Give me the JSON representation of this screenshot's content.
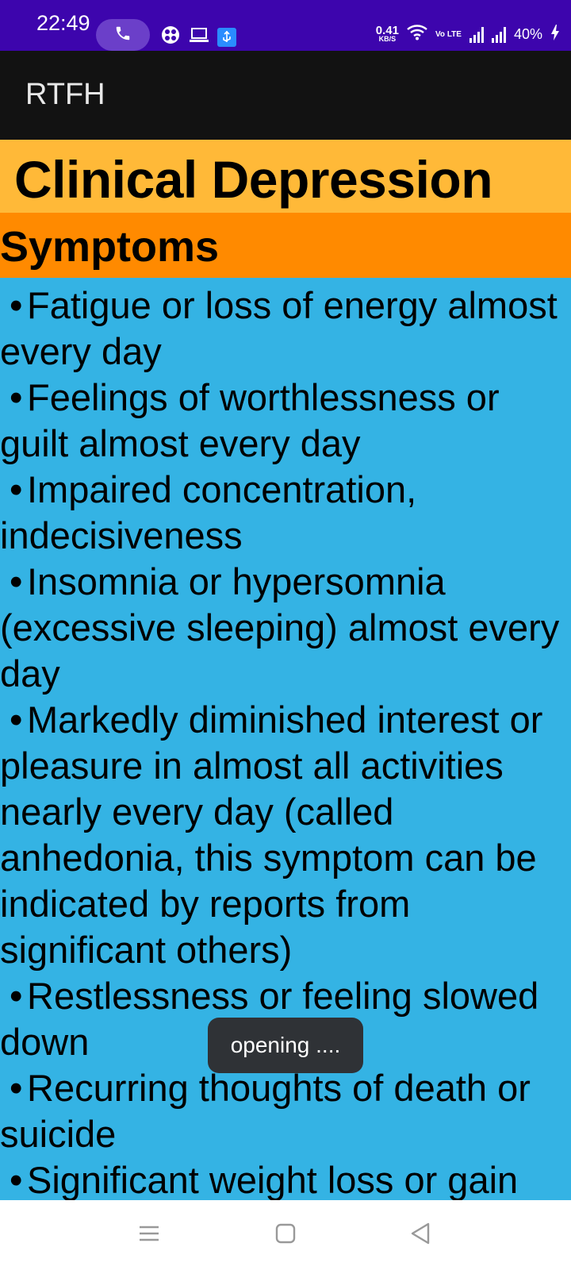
{
  "status_bar": {
    "time": "22:49",
    "speed_value": "0.41",
    "speed_unit": "KB/S",
    "volte": "Vo LTE",
    "battery": "40%"
  },
  "app_bar": {
    "title": "RTFH"
  },
  "page": {
    "title": "Clinical Depression",
    "section": "Symptoms",
    "bullet": "•",
    "items": [
      "Fatigue or loss of energy almost every day",
      "Feelings of worthlessness or guilt almost every day",
      "Impaired concentration, indecisiveness",
      "Insomnia or hypersomnia (excessive sleeping) almost every day",
      "Markedly diminished interest or pleasure in almost all activities nearly every day (called anhedonia, this symptom can be indicated by reports from significant others)",
      "Restlessness or feeling slowed down",
      "Recurring thoughts of death or suicide",
      "Significant weight loss or gain"
    ]
  },
  "toast": {
    "text": "opening ...."
  },
  "colors": {
    "status_bar_bg": "#3d05ad",
    "app_bar_bg": "#121212",
    "title_band_bg": "#ffb938",
    "section_band_bg": "#ff8a00",
    "content_bg": "#34b3e4",
    "toast_bg": "#2f3236"
  },
  "icons": {
    "status": [
      "phone-call-icon",
      "game-icon",
      "laptop-icon",
      "usb-icon",
      "wifi-icon",
      "signal-icon",
      "battery-charging-icon"
    ],
    "nav": [
      "menu-icon",
      "home-square-icon",
      "back-triangle-icon"
    ]
  }
}
